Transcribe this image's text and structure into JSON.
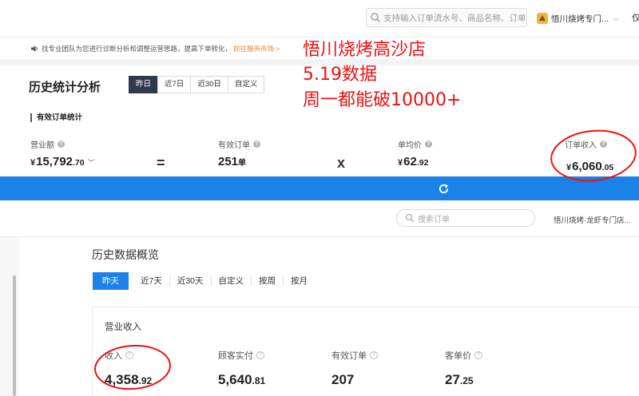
{
  "top": {
    "search_placeholder": "支持输入订单流水号、商品名称、订单",
    "store_name": "悟川烧烤专门...",
    "only_text": "仅",
    "notice_text": "找专业团队为您进行诊断分析和调整运营思路，提高下单转化，",
    "notice_link": "前往服务市场 >",
    "page_title": "历史统计分析",
    "ranges": [
      "昨日",
      "近7日",
      "近30日",
      "自定义"
    ],
    "active_range": "昨日",
    "section_title": "有效订单统计",
    "metrics": {
      "revenue": {
        "label": "营业额",
        "currency": "¥",
        "int": "15,792",
        "dec": ".70",
        "suffix": "﹀"
      },
      "orders": {
        "label": "有效订单",
        "int": "251",
        "unit": "单"
      },
      "avg_price": {
        "label": "单均价",
        "currency": "¥",
        "int": "62",
        "dec": ".92"
      },
      "order_income": {
        "label": "订单收入",
        "currency": "¥",
        "int": "6,060",
        "dec": ".05"
      }
    },
    "op_equals": "=",
    "op_times": "x"
  },
  "annotation": {
    "line1": "悟川烧烤高沙店",
    "line2": "5.19数据",
    "line3": "周一都能破10000+"
  },
  "bottom": {
    "search_placeholder": "搜索订单",
    "store_name": "悟川烧烤·龙虾专门店...",
    "overview_title": "历史数据概览",
    "tabs": [
      "昨天",
      "近7天",
      "近30天",
      "自定义",
      "按周",
      "按月"
    ],
    "active_tab": "昨天",
    "revenue_section": "营业收入",
    "metrics": [
      {
        "label": "收入",
        "int": "4,358",
        "dec": ".92"
      },
      {
        "label": "顾客实付",
        "int": "5,640",
        "dec": ".81"
      },
      {
        "label": "有效订单",
        "int": "207",
        "dec": ""
      },
      {
        "label": "客单价",
        "int": "27",
        "dec": ".25"
      }
    ]
  },
  "colors": {
    "accent_blue": "#1a82e8",
    "annotation_red": "#ee1111",
    "active_dark": "#2f3a4c",
    "link_orange": "#f0892a"
  }
}
